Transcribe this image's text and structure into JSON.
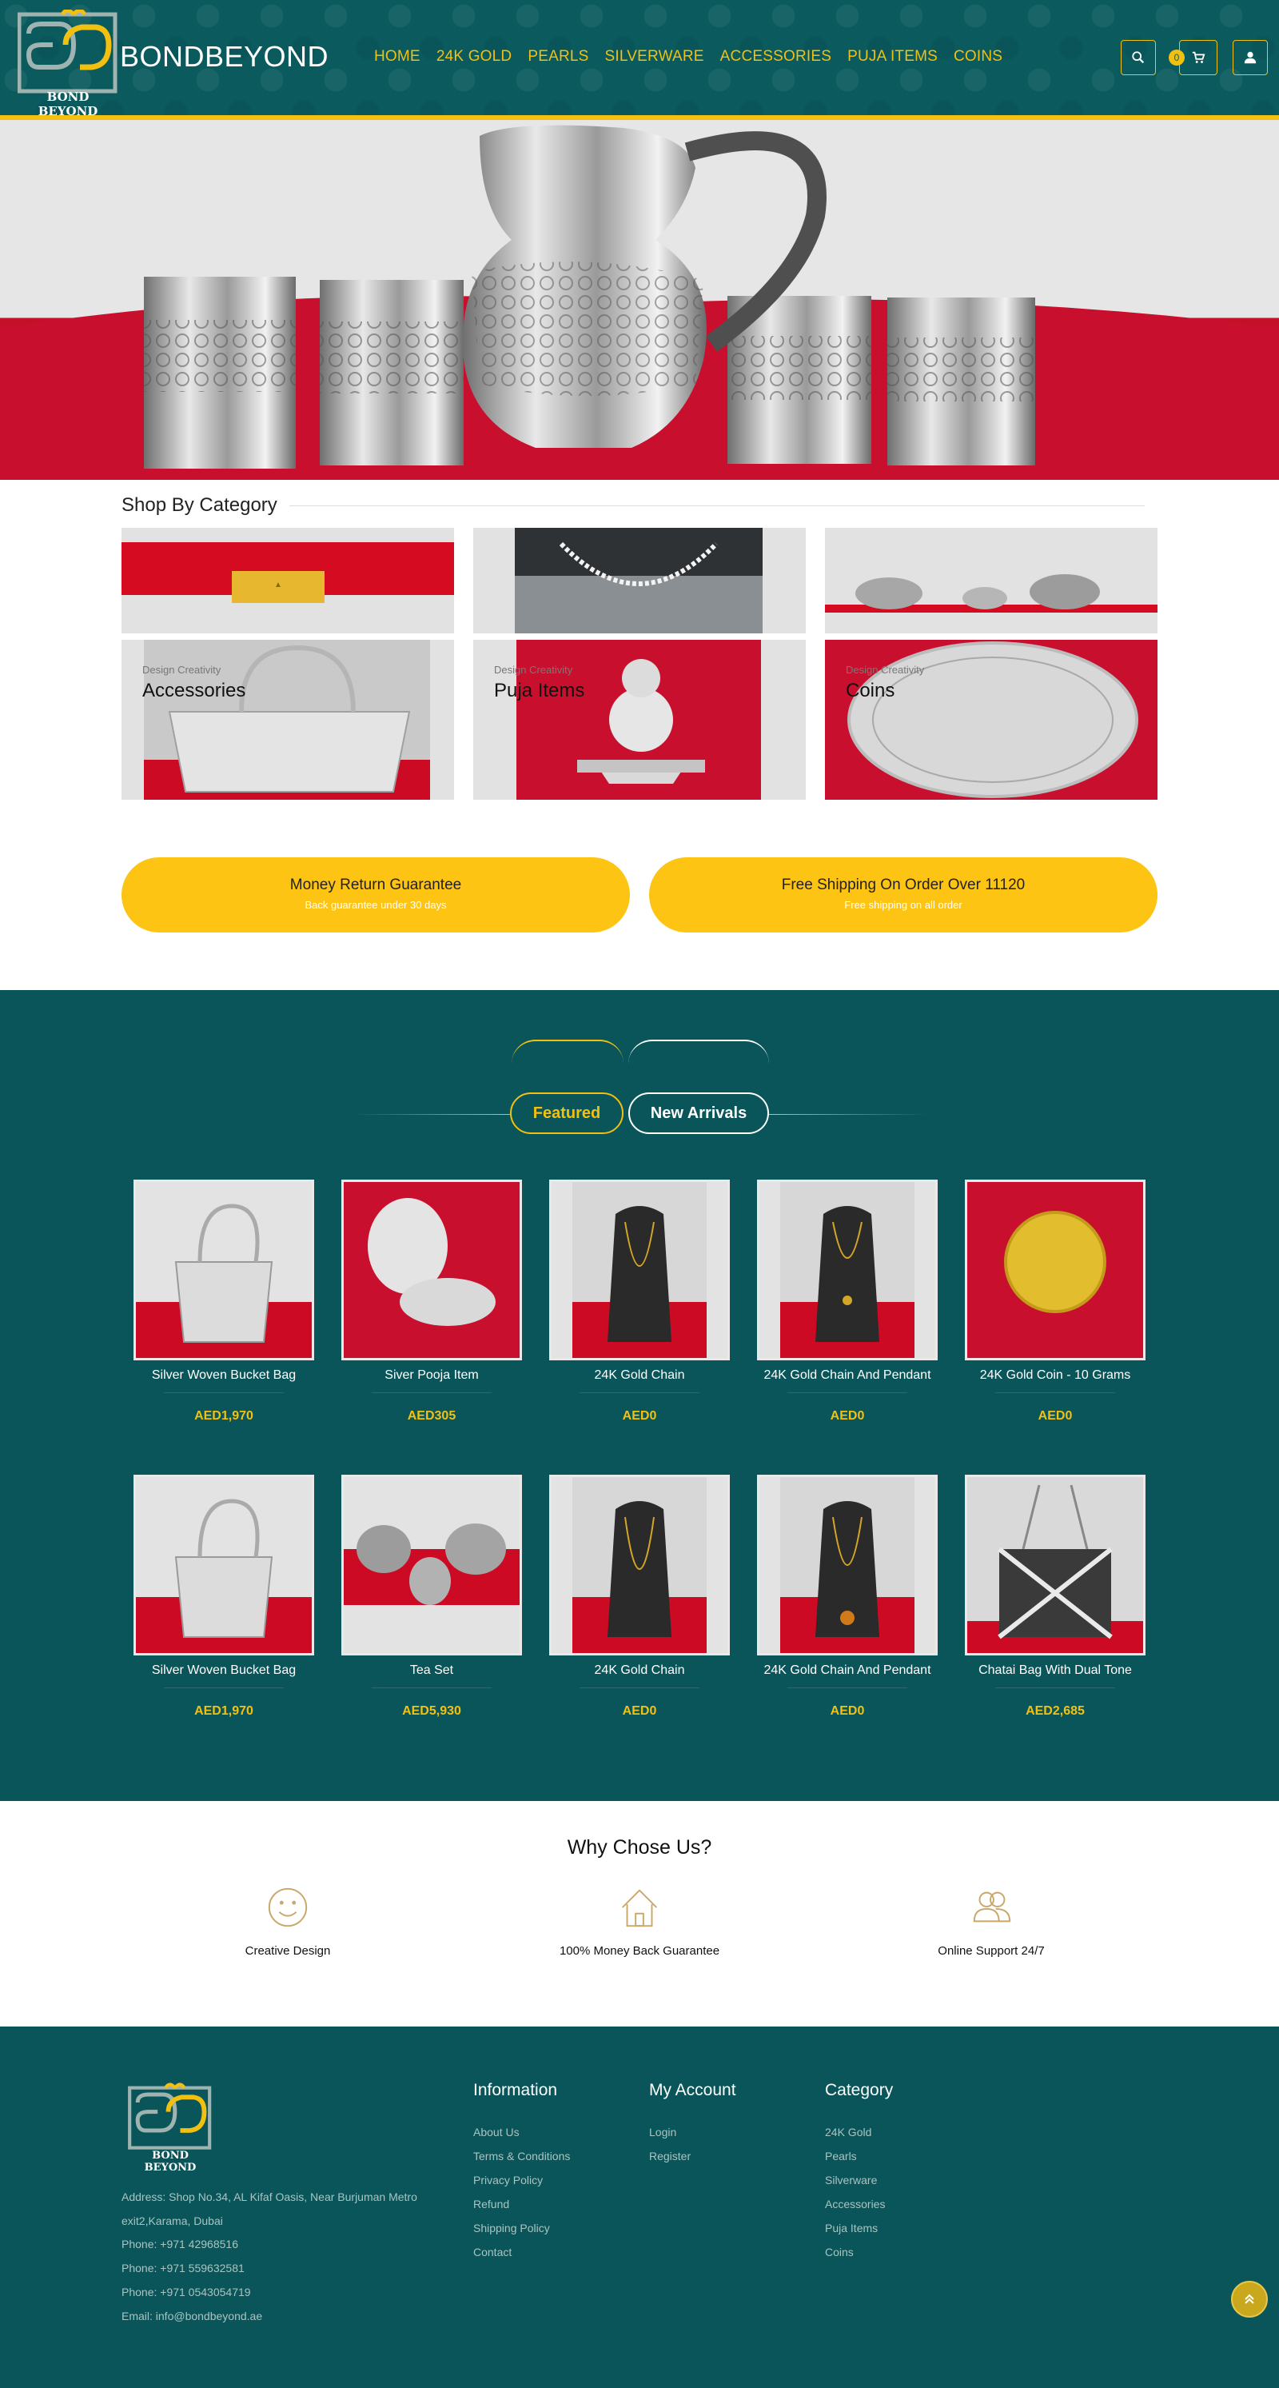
{
  "header": {
    "brand": "BONDBEYOND",
    "logo_text": "BOND BEYOND",
    "nav": [
      "HOME",
      "24K GOLD",
      "PEARLS",
      "SILVERWARE",
      "ACCESSORIES",
      "PUJA ITEMS",
      "COINS"
    ],
    "cart_count": "0",
    "accent": "#f2c011",
    "bg": "#0a5a5e"
  },
  "categories": {
    "title": "Shop By Category",
    "items": [
      {
        "sub": "Design Creativity",
        "name": "Accessories"
      },
      {
        "sub": "Design Creativity",
        "name": "Puja Items"
      },
      {
        "sub": "Design Creativity",
        "name": "Coins"
      }
    ]
  },
  "benefits": [
    {
      "title": "Money Return Guarantee",
      "sub": "Back guarantee under 30 days"
    },
    {
      "title": "Free Shipping On Order Over 11120",
      "sub": "Free shipping on all order"
    }
  ],
  "tabs": {
    "featured": "Featured",
    "new_arrivals": "New Arrivals"
  },
  "products": [
    {
      "name": "Silver Woven Bucket Bag",
      "price": "AED1,970"
    },
    {
      "name": "Siver Pooja Item",
      "price": "AED305"
    },
    {
      "name": "24K Gold Chain",
      "price": "AED0"
    },
    {
      "name": "24K Gold Chain And Pendant",
      "price": "AED0"
    },
    {
      "name": "24K Gold Coin - 10 Grams",
      "price": "AED0"
    },
    {
      "name": "Silver Woven Bucket Bag",
      "price": "AED1,970"
    },
    {
      "name": "Tea Set",
      "price": "AED5,930"
    },
    {
      "name": "24K Gold Chain",
      "price": "AED0"
    },
    {
      "name": "24K Gold Chain And Pendant",
      "price": "AED0"
    },
    {
      "name": "Chatai Bag With Dual Tone",
      "price": "AED2,685"
    }
  ],
  "why": {
    "title": "Why Chose Us?",
    "items": [
      "Creative Design",
      "100% Money Back Guarantee",
      "Online Support 24/7"
    ]
  },
  "footer": {
    "logo_text": "BOND BEYOND",
    "address": "Address: Shop No.34, AL Kifaf Oasis, Near Burjuman Metro exit2,Karama, Dubai",
    "phones": [
      "Phone: +971 42968516",
      "Phone: +971 559632581",
      "Phone: +971 0543054719"
    ],
    "email": "Email: info@bondbeyond.ae",
    "information": {
      "title": "Information",
      "links": [
        "About Us",
        "Terms & Conditions",
        "Privacy Policy",
        "Refund",
        "Shipping Policy",
        "Contact"
      ]
    },
    "account": {
      "title": "My Account",
      "links": [
        "Login",
        "Register"
      ]
    },
    "category": {
      "title": "Category",
      "links": [
        "24K Gold",
        "Pearls",
        "Silverware",
        "Accessories",
        "Puja Items",
        "Coins"
      ]
    }
  }
}
